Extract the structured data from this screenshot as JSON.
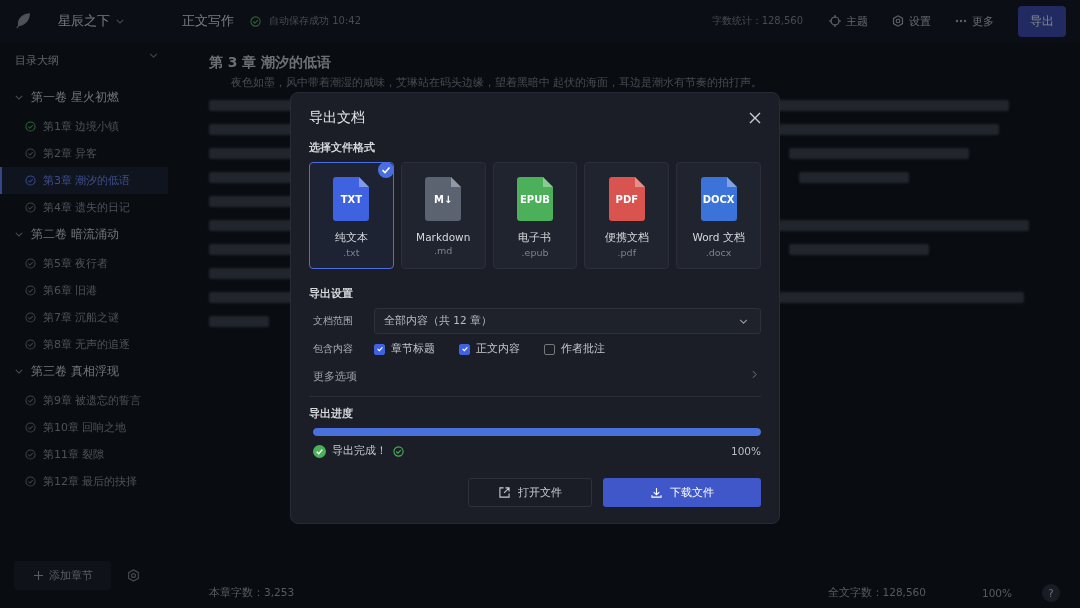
{
  "app": {
    "book_title": "星辰之下",
    "mode": "正文写作",
    "autosave": "自动保存成功 10:42",
    "word_count": "字数统计：128,560",
    "actions": [
      {
        "kind": "theme",
        "label": "主题"
      },
      {
        "kind": "settings",
        "label": "设置"
      },
      {
        "kind": "more",
        "label": "更多"
      }
    ],
    "export_button": "导出"
  },
  "sidebar": {
    "title": "目录大纲",
    "volumes": [
      {
        "title": "第一卷  星火初燃",
        "expanded": true,
        "children": [
          {
            "title": "第1章  边境小镇",
            "completed": true,
            "selected": false
          },
          {
            "title": "第2章  异客",
            "completed": false,
            "selected": false
          },
          {
            "title": "第3章  潮汐的低语",
            "completed": false,
            "selected": true
          },
          {
            "title": "第4章  遗失的日记",
            "completed": false,
            "selected": false
          }
        ]
      },
      {
        "title": "第二卷  暗流涌动",
        "expanded": true,
        "children": [
          {
            "title": "第5章  夜行者",
            "completed": false,
            "selected": false
          },
          {
            "title": "第6章  旧港",
            "completed": false,
            "selected": false
          },
          {
            "title": "第7章  沉船之谜",
            "completed": false,
            "selected": false
          },
          {
            "title": "第8章  无声的追逐",
            "completed": false,
            "selected": false
          }
        ]
      },
      {
        "title": "第三卷  真相浮现",
        "expanded": true,
        "children": [
          {
            "title": "第9章  被遗忘的誓言",
            "completed": false,
            "selected": false
          },
          {
            "title": "第10章  回响之地",
            "completed": false,
            "selected": false
          },
          {
            "title": "第11章  裂隙",
            "completed": false,
            "selected": false
          },
          {
            "title": "第12章  最后的抉择",
            "completed": false,
            "selected": false
          }
        ]
      }
    ],
    "add_button": "添加章节"
  },
  "editor": {
    "chapter_title": "第 3 章  潮汐的低语",
    "first_line": "夜色如墨，风中带着潮湿的咸味，艾琳站在码头边缘，望着黑暗中 起伏的海面，耳边是潮水有节奏的拍打声。"
  },
  "footer": {
    "chapter_words": "本章字数：3,253",
    "total_words": "全文字数：128,560",
    "zoom": "100%",
    "help": "?"
  },
  "dialog": {
    "title": "导出文档",
    "format_heading": "选择文件格式",
    "formats": [
      {
        "label": "纯文本",
        "ext": ".txt",
        "badge": "TXT",
        "color": "#3f63e0",
        "selected": true
      },
      {
        "label": "Markdown",
        "ext": ".md",
        "badge": "M↓",
        "color": "#5b6270",
        "selected": false
      },
      {
        "label": "电子书",
        "ext": ".epub",
        "badge": "EPUB",
        "color": "#4caf5a",
        "selected": false
      },
      {
        "label": "便携文档",
        "ext": ".pdf",
        "badge": "PDF",
        "color": "#d9534f",
        "selected": false
      },
      {
        "label": "Word 文档",
        "ext": ".docx",
        "badge": "DOCX",
        "color": "#3b73d9",
        "selected": false
      }
    ],
    "settings_heading": "导出设置",
    "range_label": "文档范围",
    "range_value": "全部内容（共 12 章）",
    "include_label": "包含内容",
    "options": [
      {
        "label": "章节标题",
        "checked": true
      },
      {
        "label": "正文内容",
        "checked": true
      },
      {
        "label": "作者批注",
        "checked": false
      }
    ],
    "more_options": "更多选项",
    "progress_heading": "导出进度",
    "progress": {
      "level": 1,
      "status": "导出完成！",
      "reading": "100%"
    },
    "buttons": [
      {
        "kind": "secondary",
        "label": "打开文件"
      },
      {
        "kind": "primary",
        "label": "下载文件"
      }
    ]
  }
}
